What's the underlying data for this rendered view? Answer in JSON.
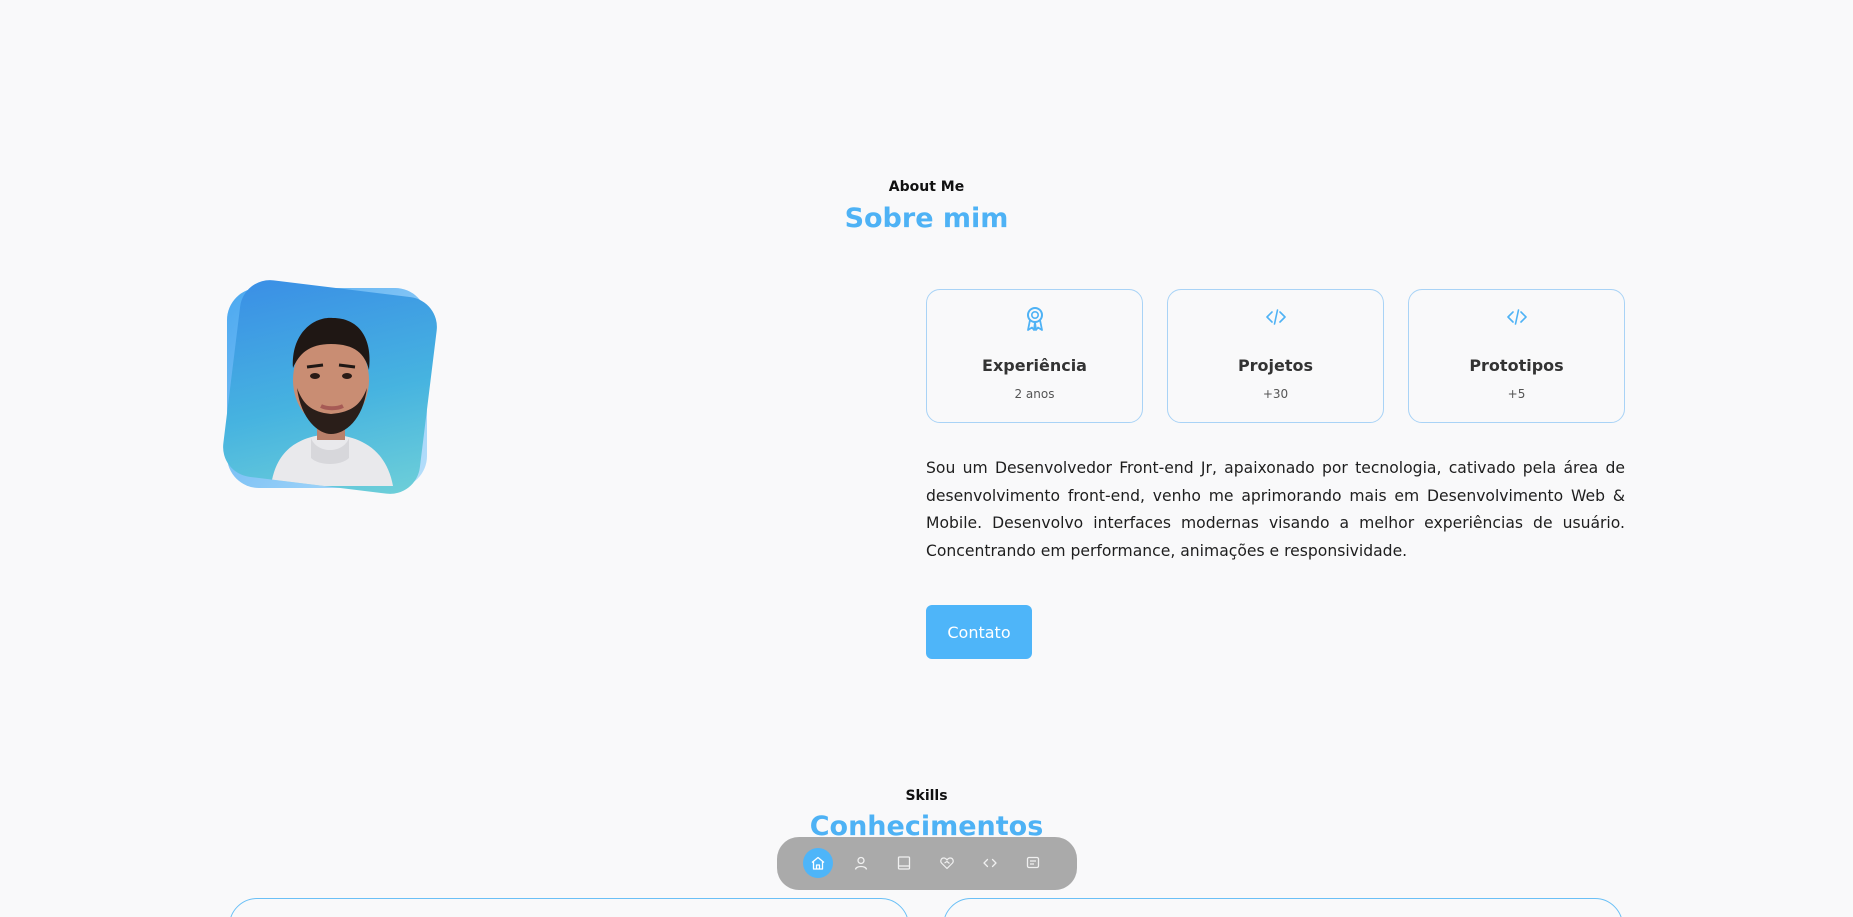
{
  "about": {
    "eyebrow": "About Me",
    "title": "Sobre mim",
    "cards": [
      {
        "title": "Experiência",
        "value": "2 anos",
        "icon": "award-icon"
      },
      {
        "title": "Projetos",
        "value": "+30",
        "icon": "code-icon"
      },
      {
        "title": "Prototipos",
        "value": "+5",
        "icon": "code-icon"
      }
    ],
    "description": "Sou um Desenvolvedor Front-end Jr, apaixonado por tecnologia, cativado pela área de desenvolvimento front-end, venho me aprimorando mais em Desenvolvimento Web & Mobile. Desenvolvo interfaces modernas visando a melhor experiências de usuário. Concentrando em performance, animações e responsividade.",
    "contact_button": "Contato"
  },
  "skills": {
    "eyebrow": "Skills",
    "title": "Conhecimentos"
  },
  "nav": {
    "items": [
      "home-icon",
      "user-icon",
      "book-icon",
      "handshake-icon",
      "code-icon",
      "message-icon"
    ],
    "active_index": 0
  },
  "colors": {
    "accent": "#4eb5f9",
    "background": "#f9f9fa",
    "card_border": "#a9d3f6"
  }
}
